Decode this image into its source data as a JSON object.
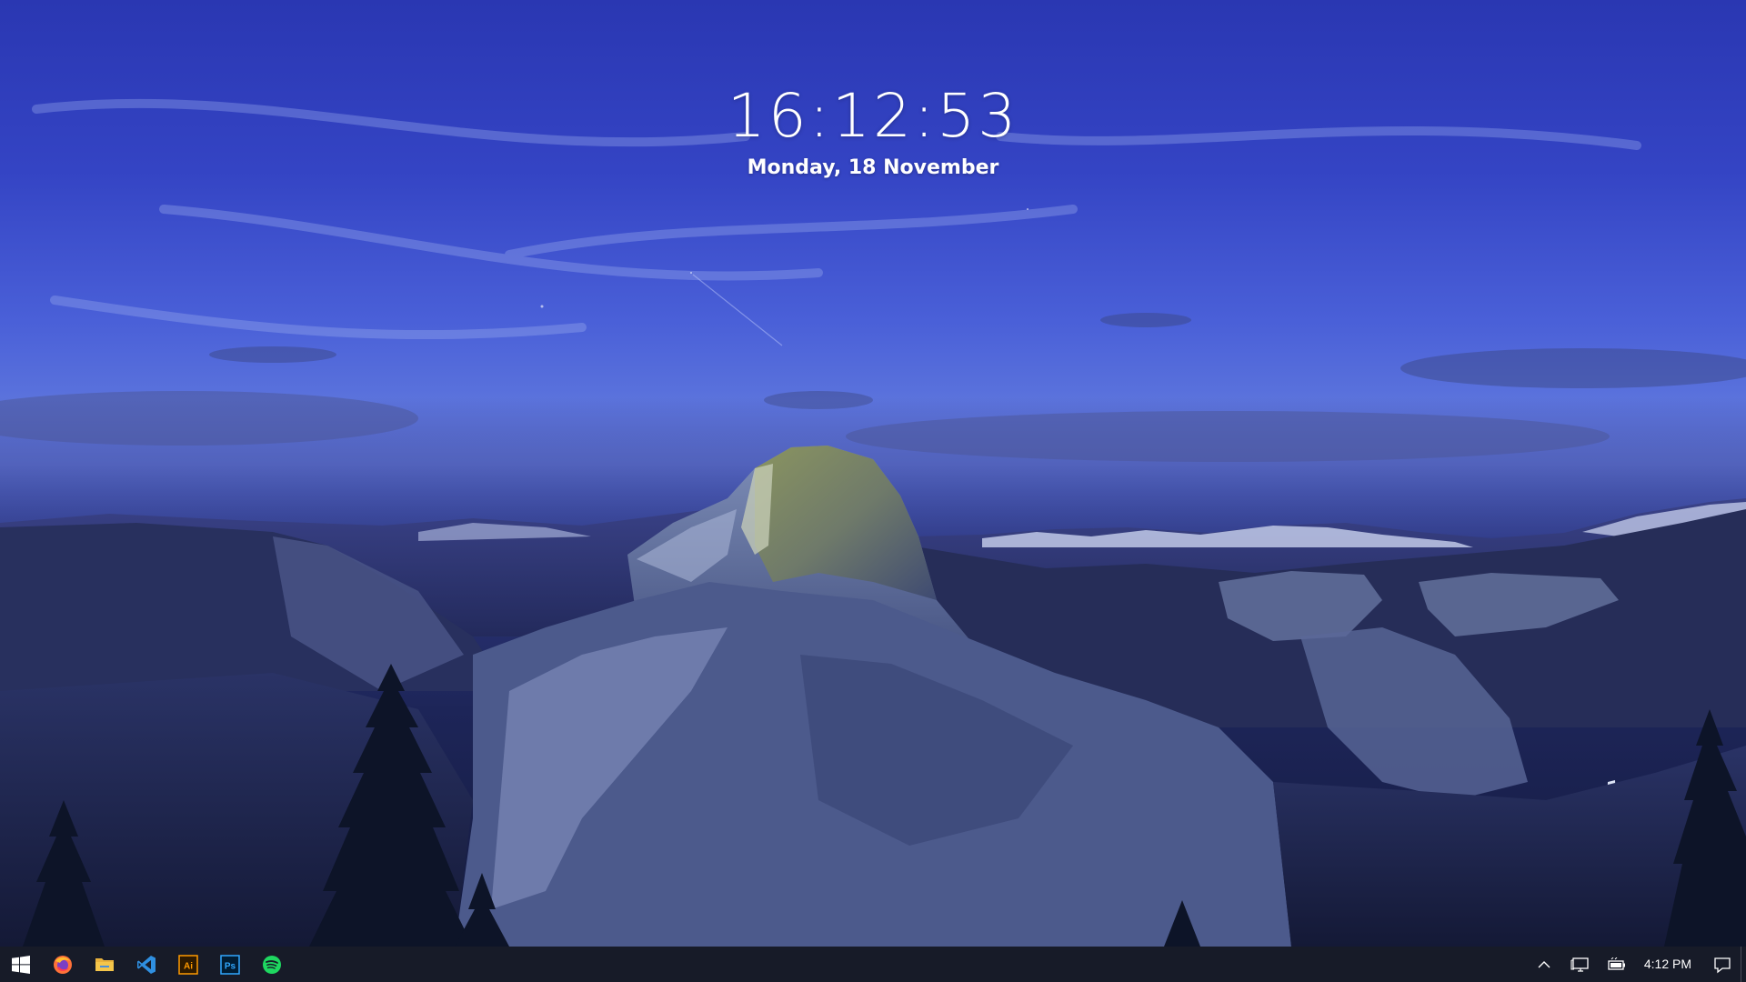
{
  "clock": {
    "time": "16:12:53",
    "date": "Monday, 18 November"
  },
  "taskbar": {
    "apps": [
      {
        "name": "start",
        "icon": "windows-logo-icon"
      },
      {
        "name": "firefox",
        "icon": "firefox-icon"
      },
      {
        "name": "file-explorer",
        "icon": "folder-icon"
      },
      {
        "name": "vscode",
        "icon": "vscode-icon"
      },
      {
        "name": "illustrator",
        "icon": "illustrator-icon",
        "label": "Ai"
      },
      {
        "name": "photoshop",
        "icon": "photoshop-icon",
        "label": "Ps"
      },
      {
        "name": "spotify",
        "icon": "spotify-icon"
      }
    ],
    "tray": {
      "time": "4:12 PM",
      "icons": [
        "chevron-up-icon",
        "network-icon",
        "battery-icon",
        "notification-icon"
      ]
    }
  },
  "colors": {
    "taskbar": "#171b28",
    "sky_top": "#2a37b2",
    "sky_mid": "#5a72dc",
    "firefox": "#ff7139",
    "folder": "#f4c54a",
    "vscode": "#2f8fe0",
    "illustrator": "#ff9a00",
    "photoshop": "#31a8ff",
    "spotify": "#1ed760"
  }
}
